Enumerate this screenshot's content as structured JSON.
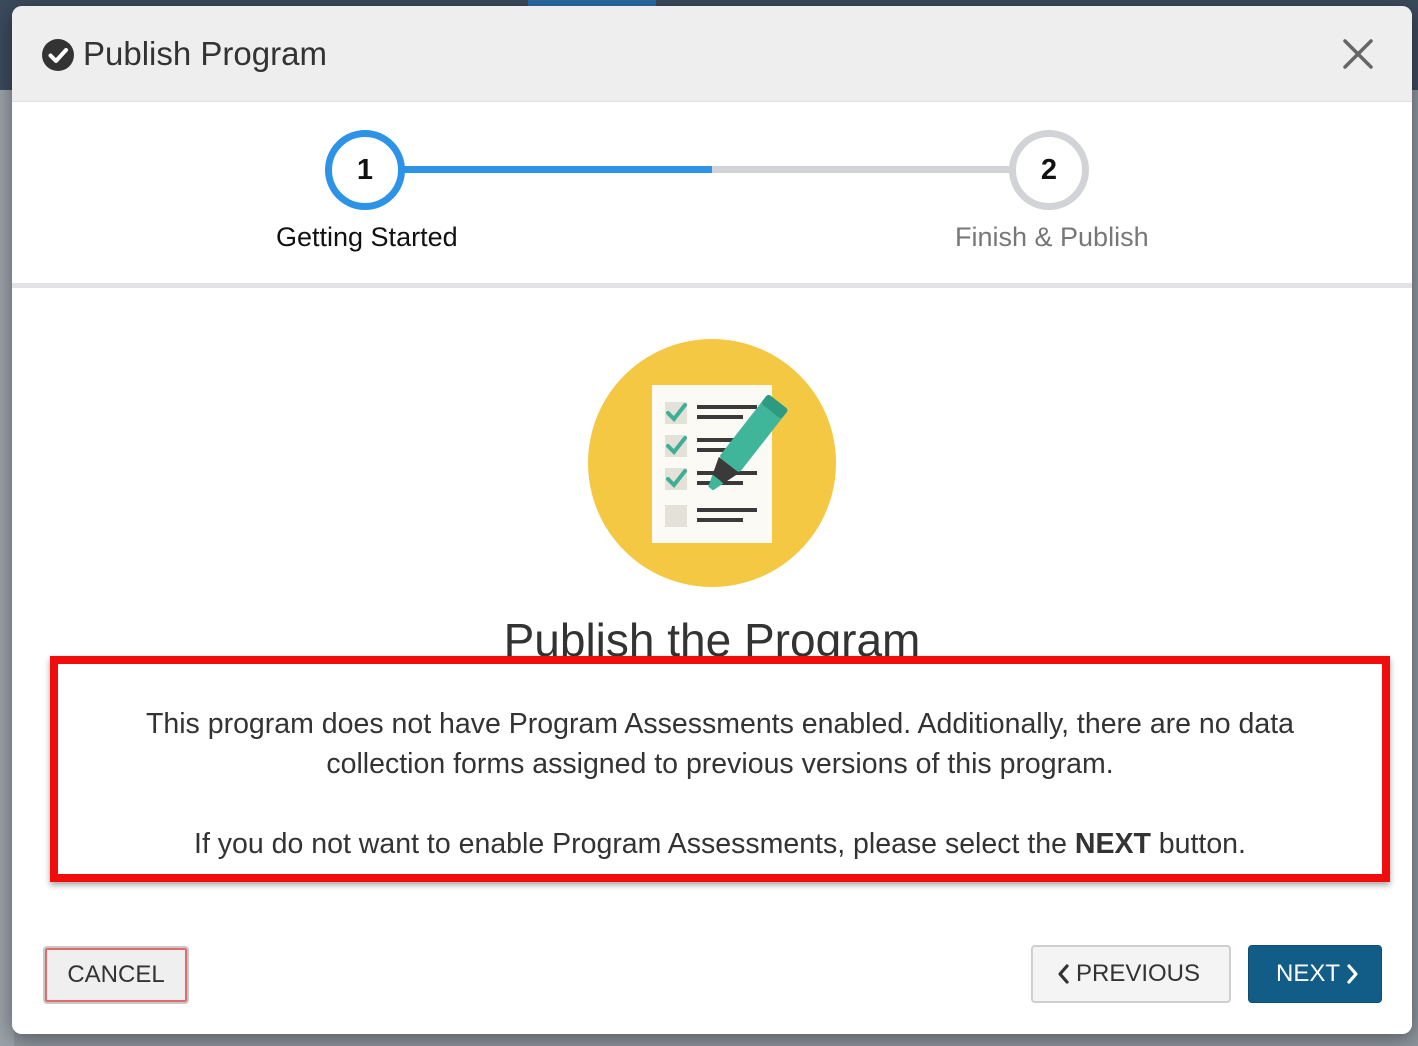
{
  "modal": {
    "title": "Publish Program",
    "icons": {
      "title_icon": "check-circle-icon",
      "close_icon": "close-icon"
    }
  },
  "stepper": {
    "steps": [
      {
        "number": "1",
        "label": "Getting Started",
        "state": "active"
      },
      {
        "number": "2",
        "label": "Finish & Publish",
        "state": "inactive"
      }
    ],
    "progress": 0.5,
    "colors": {
      "active": "#2d93e6",
      "inactive": "#d2d3d6"
    }
  },
  "content": {
    "illustration": "checklist-highlighter-icon",
    "heading": "Publish the Program",
    "message_line1": "This program does not have Program Assessments enabled. Additionally, there are no data",
    "message_line2": "collection forms assigned to previous versions of this program.",
    "message_line3_pre": "If you do not want to enable Program Assessments, please select the ",
    "message_line3_bold": "NEXT",
    "message_line3_post": " button.",
    "highlight_color": "#f20d0d"
  },
  "footer": {
    "cancel_label": "CANCEL",
    "previous_label": "PREVIOUS",
    "next_label": "NEXT",
    "next_color": "#115d87"
  }
}
